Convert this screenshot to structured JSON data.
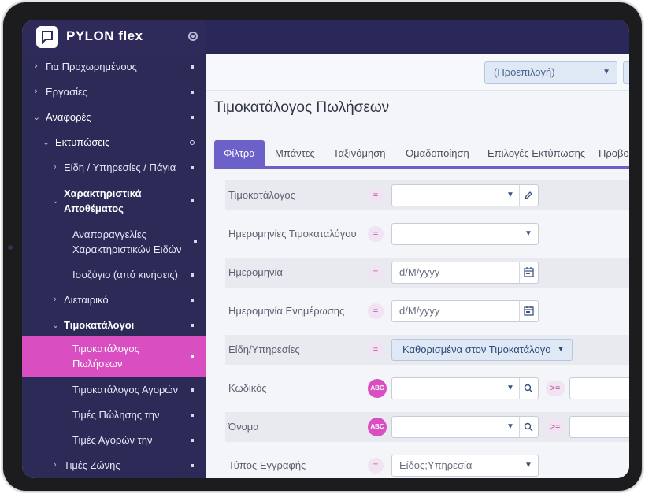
{
  "app": {
    "brand": "PYLON flex"
  },
  "sidebar": {
    "items": [
      {
        "label": "Για Προχωρημένους"
      },
      {
        "label": "Εργασίες"
      },
      {
        "label": "Αναφορές"
      },
      {
        "label": "Εκτυπώσεις"
      },
      {
        "label": "Είδη / Υπηρεσίες / Πάγια"
      },
      {
        "label": "Χαρακτηριστικά Αποθέματος"
      },
      {
        "label": "Αναπαραγγελίες Χαρακτηριστικών Ειδών"
      },
      {
        "label": "Ισοζύγιο (από κινήσεις)"
      },
      {
        "label": "Διεταιρικό"
      },
      {
        "label": "Τιμοκατάλογοι"
      },
      {
        "label": "Τιμοκατάλογος Πωλήσεων"
      },
      {
        "label": "Τιμοκατάλογος Αγορών"
      },
      {
        "label": "Τιμές Πώλησης την"
      },
      {
        "label": "Τιμές Αγορών την"
      },
      {
        "label": "Τιμές Ζώνης"
      }
    ]
  },
  "toolbar": {
    "preset_value": "(Προεπιλογή)"
  },
  "page": {
    "title": "Τιμοκατάλογος Πωλήσεων"
  },
  "tabs": [
    {
      "label": "Φίλτρα"
    },
    {
      "label": "Μπάντες"
    },
    {
      "label": "Ταξινόμηση"
    },
    {
      "label": "Ομαδοποίηση"
    },
    {
      "label": "Επιλογές Εκτύπωσης"
    },
    {
      "label": "Προβολ"
    }
  ],
  "filters": [
    {
      "label": "Τιμοκατάλογος",
      "op": "=",
      "value": ""
    },
    {
      "label": "Ημερομηνίες Τιμοκαταλόγου",
      "op": "=",
      "value": ""
    },
    {
      "label": "Ημερομηνία",
      "op": "=",
      "placeholder": "d/M/yyyy"
    },
    {
      "label": "Ημερομηνία Ενημέρωσης",
      "op": "=",
      "placeholder": "d/M/yyyy"
    },
    {
      "label": "Είδη/Υπηρεσίες",
      "op": "=",
      "value": "Καθορισμένα στον Τιμοκατάλογο"
    },
    {
      "label": "Κωδικός",
      "op": "ABC",
      "op2": ">=",
      "value": ""
    },
    {
      "label": "Όνομα",
      "op": "ABC",
      "op2": ">=",
      "value": ""
    },
    {
      "label": "Τύπος Εγγραφής",
      "op": "=",
      "value": "Είδος;Υπηρεσία"
    }
  ]
}
